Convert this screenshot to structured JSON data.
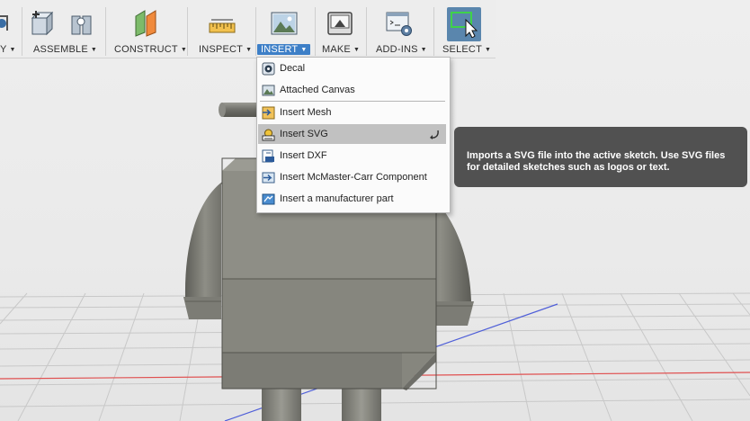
{
  "toolbar": {
    "groups": [
      {
        "id": "partial",
        "label": "Y",
        "icon": "sketch-icon"
      },
      {
        "id": "assemble",
        "label": "ASSEMBLE",
        "icon": "assemble-icon"
      },
      {
        "id": "construct",
        "label": "CONSTRUCT",
        "icon": "construct-plane-icon"
      },
      {
        "id": "inspect",
        "label": "INSPECT",
        "icon": "measure-ruler-icon"
      },
      {
        "id": "insert",
        "label": "INSERT",
        "icon": "insert-image-icon",
        "active": true
      },
      {
        "id": "make",
        "label": "MAKE",
        "icon": "3d-print-icon"
      },
      {
        "id": "addins",
        "label": "ADD-INS",
        "icon": "scripts-gear-icon"
      },
      {
        "id": "select",
        "label": "SELECT",
        "icon": "select-cursor-icon",
        "selected": true
      }
    ],
    "caret": "▼"
  },
  "insert_menu": {
    "items": [
      {
        "label": "Decal",
        "icon": "decal-icon"
      },
      {
        "label": "Attached Canvas",
        "icon": "canvas-image-icon"
      },
      {
        "label": "Insert Mesh",
        "icon": "insert-mesh-icon"
      },
      {
        "label": "Insert SVG",
        "icon": "insert-svg-icon",
        "highlighted": true
      },
      {
        "label": "Insert DXF",
        "icon": "insert-dxf-icon"
      },
      {
        "label": "Insert McMaster-Carr Component",
        "icon": "mcmaster-carr-icon"
      },
      {
        "label": "Insert a manufacturer part",
        "icon": "manufacturer-part-icon"
      }
    ],
    "pin_icon": "curved-arrow-icon"
  },
  "tooltip": {
    "text": "Imports a SVG file into the active sketch. Use SVG files for detailed sketches such as logos or text."
  },
  "colors": {
    "toolbar_bg": "#ededed",
    "active_tab": "#3d7fc7",
    "select_button": "#5a86ad",
    "menu_highlight": "#c1c1c1",
    "tooltip_bg": "#515151",
    "model_gray": "#8a8a80",
    "grid_red_axis": "#e05050",
    "grid_blue_axis": "#4f5fd8"
  }
}
